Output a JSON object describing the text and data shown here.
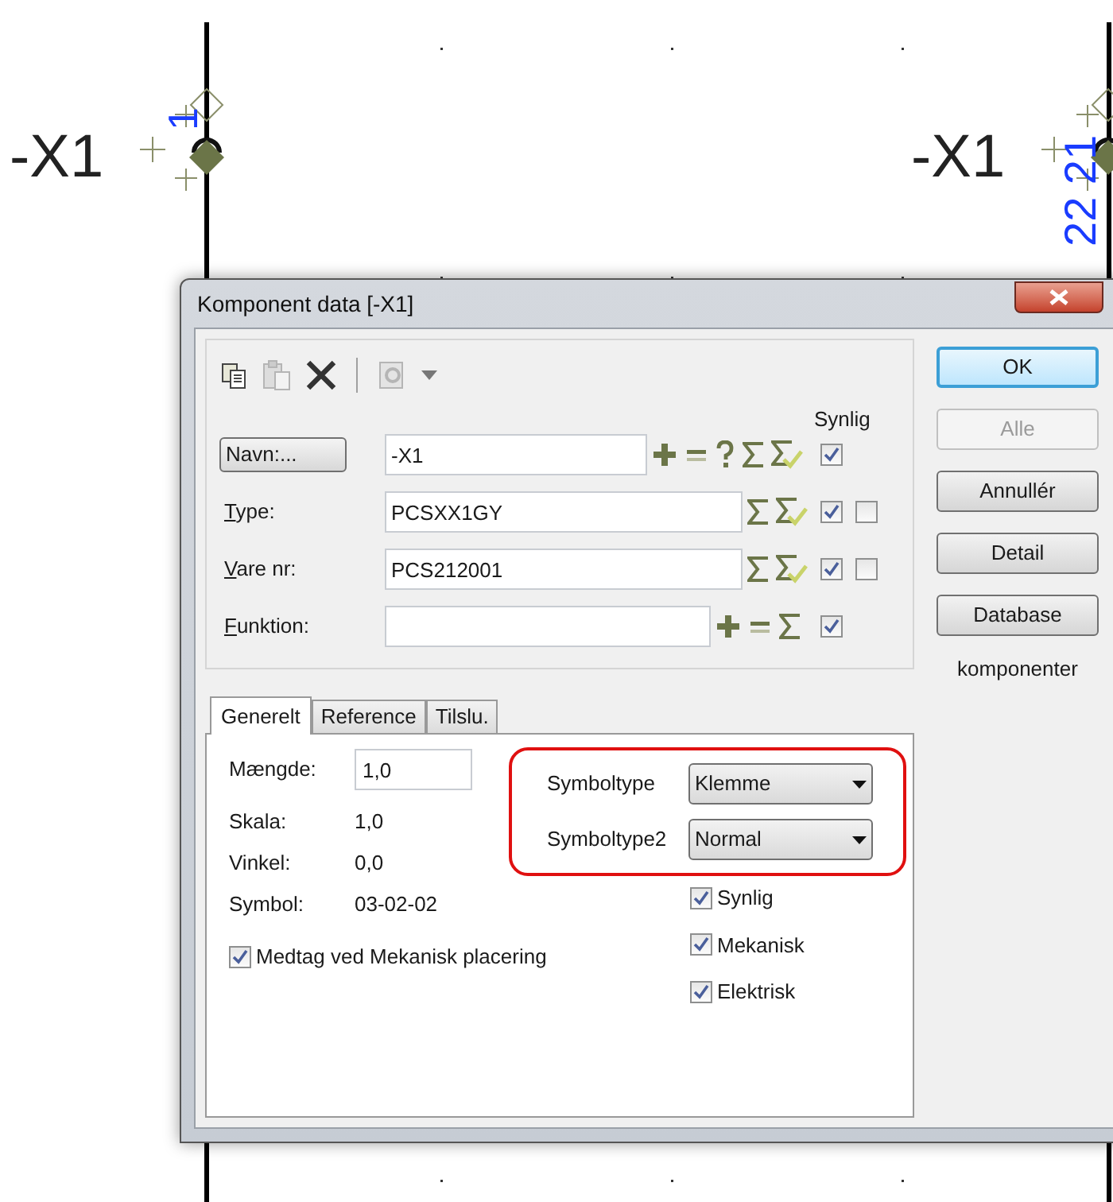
{
  "canvas": {
    "symbols": [
      {
        "designation": "-X1",
        "pin_label": "1"
      },
      {
        "designation": "-X1",
        "pin_label": "22 21"
      }
    ]
  },
  "window": {
    "title": "Komponent data [-X1]"
  },
  "toolbar": [
    {
      "kind": "copy",
      "disabled": false
    },
    {
      "kind": "paste",
      "disabled": true
    },
    {
      "kind": "delete",
      "disabled": false
    },
    {
      "kind": "separator"
    },
    {
      "kind": "database",
      "disabled": true
    },
    {
      "kind": "caret"
    }
  ],
  "visible_header": "Synlig",
  "fields": [
    {
      "kind": "button",
      "label": "Navn:...",
      "value": "-X1",
      "tools": [
        {
          "kind": "plus"
        },
        {
          "kind": "minus"
        },
        {
          "kind": "help"
        },
        {
          "kind": "sum"
        },
        {
          "kind": "sum-check"
        }
      ],
      "visible": true
    },
    {
      "kind": "label",
      "label": "Type:",
      "value": "PCSXX1GY",
      "tools": [
        {
          "kind": "sum"
        },
        {
          "kind": "sum-check"
        }
      ],
      "visible": true,
      "extra": false
    },
    {
      "kind": "label",
      "label": "Vare nr:",
      "value": "PCS212001",
      "tools": [
        {
          "kind": "sum"
        },
        {
          "kind": "sum-check"
        }
      ],
      "visible": true,
      "extra": false
    },
    {
      "kind": "label",
      "label": "Funktion:",
      "tools": [
        {
          "kind": "plus"
        },
        {
          "kind": "minus"
        },
        {
          "kind": "sum"
        }
      ],
      "visible": true
    }
  ],
  "buttons": [
    {
      "label": "OK",
      "default": true,
      "disabled": false
    },
    {
      "label": "Alle",
      "default": false,
      "disabled": true
    },
    {
      "label": "Annullér",
      "default": false,
      "disabled": false
    },
    {
      "label": "Detail",
      "default": false,
      "disabled": false
    },
    {
      "label": "Database",
      "default": false,
      "disabled": false
    }
  ],
  "buttons_note": "komponenter",
  "tabs": [
    {
      "label": "Generelt",
      "selected": true
    },
    {
      "label": "Reference",
      "selected": false
    },
    {
      "label": "Tilslu.",
      "selected": false
    }
  ],
  "general": {
    "quantity": {
      "label": "Mængde:",
      "value": "1,0"
    },
    "properties": [
      {
        "label": "Skala:",
        "value": "1,0"
      },
      {
        "label": "Vinkel:",
        "value": "0,0"
      },
      {
        "label": "Symbol:",
        "value": "03-02-02"
      }
    ],
    "mechanical_placement": {
      "label": "Medtag ved Mekanisk placering",
      "checked": true
    },
    "symbol_types": {
      "highlighted": true,
      "items": [
        {
          "label": "Symboltype",
          "value": "Klemme"
        },
        {
          "label": "Symboltype2",
          "value": "Normal"
        }
      ]
    },
    "options": [
      {
        "label": "Synlig",
        "checked": true
      },
      {
        "label": "Mekanisk",
        "checked": true
      },
      {
        "label": "Elektrisk",
        "checked": true
      }
    ]
  }
}
